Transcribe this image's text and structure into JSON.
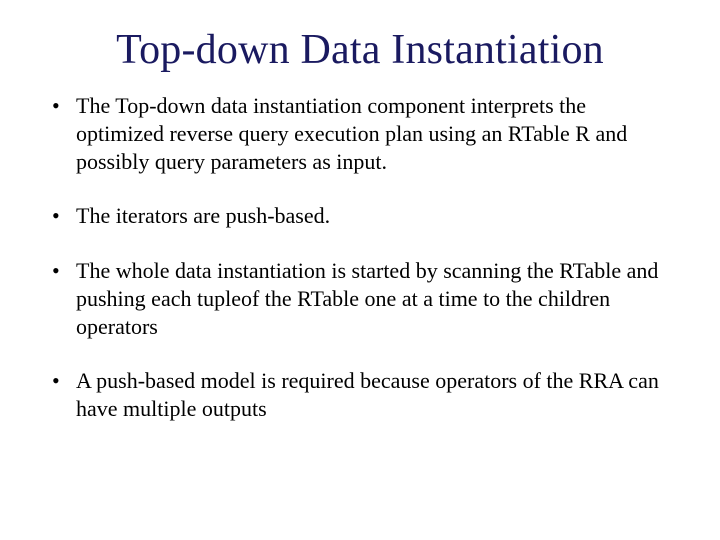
{
  "title": "Top-down Data Instantiation",
  "bullets": [
    "The Top-down data instantiation component interprets the optimized reverse query execution plan using an RTable R and possibly query parameters as input.",
    "The iterators are push-based.",
    "The whole data instantiation is started by scanning the RTable and pushing each tupleof the RTable one at a time to the children operators",
    "A push-based model is required because operators of the RRA can have multiple outputs"
  ]
}
